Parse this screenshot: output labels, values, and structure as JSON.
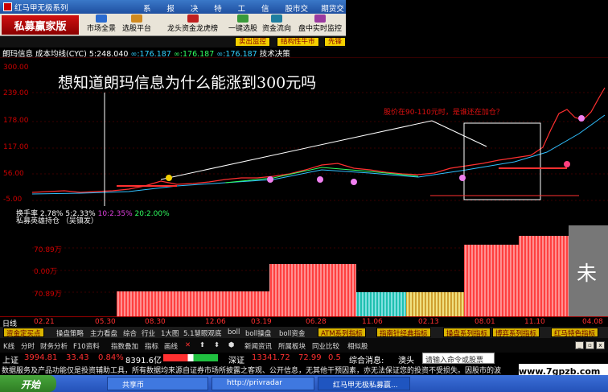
{
  "window": {
    "title": "红马甲无极系列"
  },
  "menu": [
    "系统",
    "报价",
    "决策",
    "特色",
    "工具",
    "信息",
    "股市交易",
    "期货交易"
  ],
  "toolbar": {
    "brand": "私募赢家版",
    "buttons": [
      "市场全景",
      "选股平台",
      "龙头资金龙虎榜",
      "一键选股",
      "资金流向",
      "盘中实时监控"
    ],
    "sub_buttons": [
      "卖出监控",
      "结构性牛市",
      "先锋"
    ]
  },
  "info_bar": {
    "name": "朗玛信息",
    "indicator": "成本均线(CYC)",
    "value1": "5:248.040",
    "value2": "∞:176.187",
    "value3": "∞:176.187",
    "value4": "∞:176.187",
    "tech_label": "技术决策"
  },
  "overlay": {
    "headline": "想知道朗玛信息为什么能涨到300元吗",
    "annotation": "股价在90-110元时，是谁还在加仓？"
  },
  "price_axis": [
    "300.00",
    "239.00",
    "178.00",
    "117.00",
    "56.00",
    "-5.00"
  ],
  "turnover": {
    "label": "换手率",
    "v1": "2.78%",
    "v2": "5:2.33%",
    "v3": "10:2.35%",
    "v4": "20:2.00%"
  },
  "lower_panel": {
    "label": "私募英雄持仓",
    "sub": "（吴镇发）",
    "axis": [
      "70.89万",
      "0.00万",
      "70.89万",
      "0.00万",
      "70.89万"
    ],
    "unfinished": "未"
  },
  "date_axis": {
    "label": "日线",
    "dates": [
      "02.21",
      "05.30",
      "08.30",
      "12.06",
      "03.19",
      "06.28",
      "11.06",
      "02.13",
      "08.01",
      "11.10",
      "04.08"
    ]
  },
  "tabs_row1": {
    "left": [
      "资金定买点",
      "操盘策略",
      "主力看盘",
      "综合",
      "行业",
      "1大图",
      "5.1慧眼观底",
      "boll",
      "boll操盘",
      "boll资金"
    ],
    "right": [
      "ATM系列指标",
      "指南针经典指标",
      "操盘系列指标",
      "博弈系列指标",
      "红马特色指标"
    ]
  },
  "tabs_row2": [
    "K线",
    "分时",
    "财务分析",
    "F10资料",
    "指数叠加",
    "指标",
    "画线",
    "新闻资讯",
    "所属板块",
    "同业比较",
    "相似股"
  ],
  "ticker": {
    "sh_label": "上证",
    "sh_value": "3994.81",
    "sh_change": "33.43",
    "sh_pct": "0.84%",
    "sh_amount": "8391.6亿",
    "sz_label": "深证",
    "sz_value": "13341.72",
    "sz_change": "72.99",
    "sz_pct": "0.5",
    "msg_label": "综合消息:",
    "msg": "澳头",
    "cmd_placeholder": "请输入命令或股票"
  },
  "scroll_text": "数据服务及产品功能仅是投资辅助工具，所有数据均来源自证券市场所披露之客观、公开信息，无其他干预因素，亦无法保证您的投资不受损失。因股市的波",
  "watermark": "www.7gpzb.com",
  "taskbar": {
    "start": "开始",
    "tasks": [
      "共享币",
      "http://privradar",
      "红马甲无极私募赢..."
    ]
  },
  "colors": {
    "up": "#ff3030",
    "down": "#00c0c0",
    "accent": "#f4d000"
  }
}
